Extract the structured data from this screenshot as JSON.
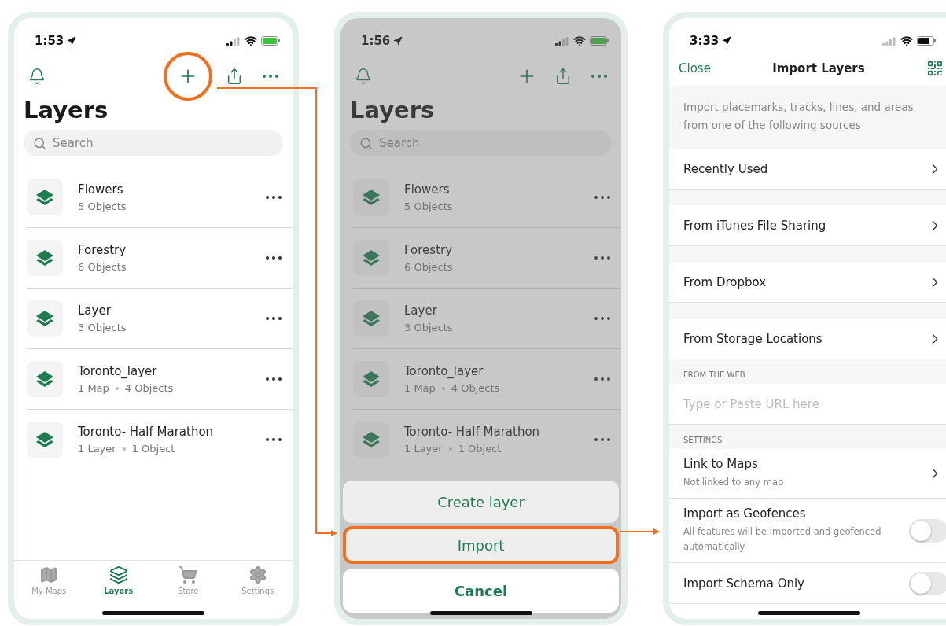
{
  "screens": [
    {
      "kind": "layers",
      "time": "1:53",
      "add_highlighted": true,
      "title": "Layers",
      "search": {
        "placeholder": "Search"
      },
      "layers": [
        {
          "name": "Flowers",
          "meta": [
            "5 Objects"
          ]
        },
        {
          "name": "Forestry",
          "meta": [
            "6 Objects"
          ]
        },
        {
          "name": "Layer",
          "meta": [
            "3 Objects"
          ]
        },
        {
          "name": "Toronto_layer",
          "meta": [
            "1 Map",
            "4 Objects"
          ]
        },
        {
          "name": "Toronto- Half Marathon",
          "meta": [
            "1 Layer",
            "1 Object"
          ]
        }
      ],
      "tabs": [
        {
          "kind": "maps",
          "label": "My Maps",
          "selected": false
        },
        {
          "kind": "layers",
          "label": "Layers",
          "selected": true
        },
        {
          "kind": "store",
          "label": "Store",
          "selected": false
        },
        {
          "kind": "settings",
          "label": "Settings",
          "selected": false
        }
      ]
    },
    {
      "kind": "layers",
      "time": "1:56",
      "add_highlighted": false,
      "title": "Layers",
      "search": {
        "placeholder": "Search"
      },
      "layers": [
        {
          "name": "Flowers",
          "meta": [
            "5 Objects"
          ]
        },
        {
          "name": "Forestry",
          "meta": [
            "6 Objects"
          ]
        },
        {
          "name": "Layer",
          "meta": [
            "3 Objects"
          ]
        },
        {
          "name": "Toronto_layer",
          "meta": [
            "1 Map",
            "4 Objects"
          ]
        },
        {
          "name": "Toronto- Half Marathon",
          "meta": [
            "1 Layer",
            "1 Object"
          ]
        }
      ],
      "sheet": {
        "actions": [
          {
            "label": "Create layer",
            "highlighted": false
          },
          {
            "label": "Import",
            "highlighted": true
          }
        ],
        "cancel": "Cancel"
      }
    },
    {
      "kind": "import",
      "time": "3:33",
      "close": "Close",
      "title": "Import Layers",
      "intro": "Import placemarks, tracks, lines, and areas from one of the following sources",
      "sections": [
        {
          "items": [
            {
              "kind": "link",
              "label": "Recently Used"
            }
          ]
        },
        {
          "items": [
            {
              "kind": "link",
              "label": "From iTunes File Sharing"
            }
          ]
        },
        {
          "items": [
            {
              "kind": "link",
              "label": "From Dropbox"
            }
          ]
        },
        {
          "items": [
            {
              "kind": "link",
              "label": "From Storage Locations"
            }
          ]
        },
        {
          "header": "FROM THE WEB",
          "items": [
            {
              "kind": "input",
              "placeholder": "Type or Paste URL here"
            }
          ]
        },
        {
          "header": "SETTINGS",
          "items": [
            {
              "kind": "link",
              "label": "Link to Maps",
              "sublabel": "Not linked to any map"
            },
            {
              "kind": "toggle",
              "label": "Import as Geofences",
              "sublabel": "All features will be imported and geofenced automatically.",
              "on": false
            },
            {
              "kind": "toggle",
              "label": "Import Schema Only",
              "on": false
            }
          ]
        }
      ]
    }
  ]
}
